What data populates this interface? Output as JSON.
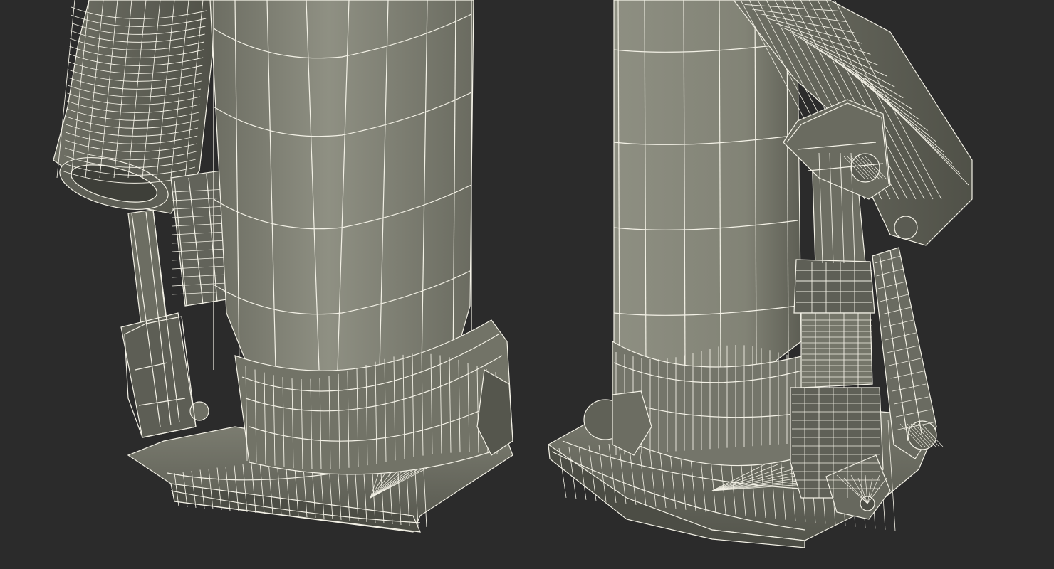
{
  "scene": {
    "subject": "hydraulic-bottle-jack-wireframe",
    "views": [
      "front-left",
      "rear-right"
    ],
    "colors": {
      "background": "#2b2b2b",
      "shade_light": "#8e8f82",
      "shade_mid": "#75766a",
      "shade_dark": "#5b5c52",
      "shade_deep": "#45463f",
      "wire": "#f3f1e6"
    }
  }
}
